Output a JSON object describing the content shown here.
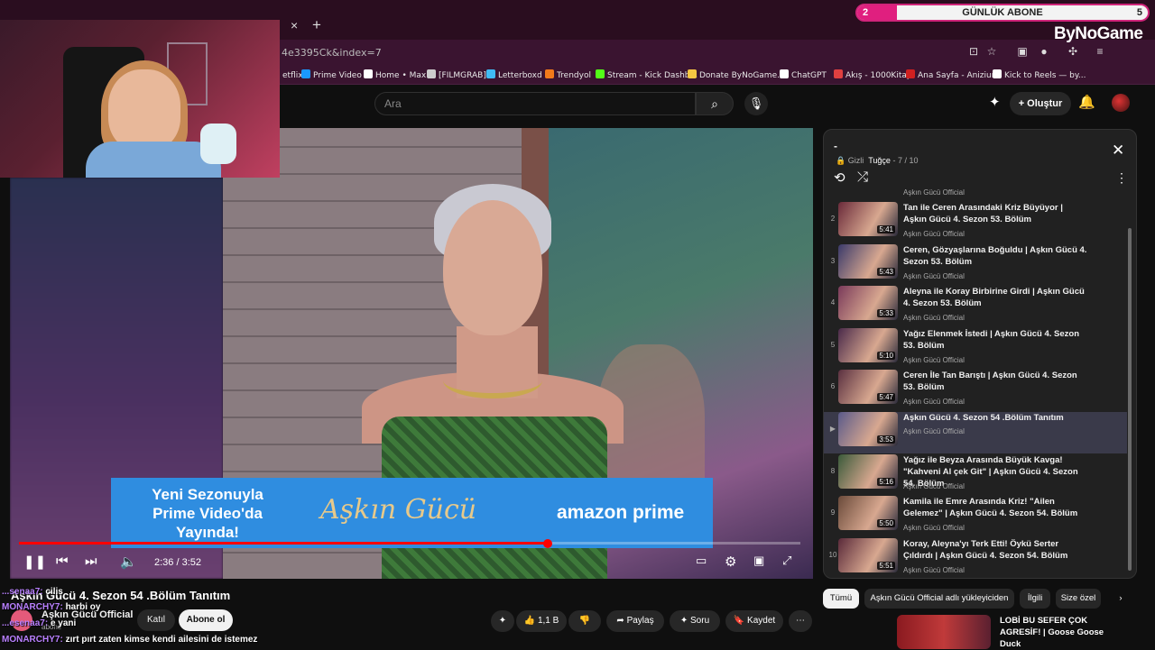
{
  "browser": {
    "tab_close": "×",
    "tab_new": "+",
    "url": "4e3395Ck&index=7",
    "bookmarks": [
      {
        "label": "etflix",
        "color": "#e50914"
      },
      {
        "label": "Prime Video",
        "color": "#1a98ff"
      },
      {
        "label": "Home • Max",
        "color": "#ffffff"
      },
      {
        "label": "[FILMGRAB]",
        "color": "#cccccc"
      },
      {
        "label": "Letterboxd",
        "color": "#40bcf4"
      },
      {
        "label": "Trendyol",
        "color": "#f27a1a"
      },
      {
        "label": "Stream - Kick Dashb...",
        "color": "#53fc18"
      },
      {
        "label": "Donate ByNoGame...",
        "color": "#f5c542"
      },
      {
        "label": "ChatGPT",
        "color": "#ffffff"
      },
      {
        "label": "Akış - 1000Kitap",
        "color": "#e04040"
      },
      {
        "label": "Ana Sayfa - Anizium",
        "color": "#d02020"
      },
      {
        "label": "Kick to Reels — by...",
        "color": "#ffffff"
      }
    ]
  },
  "overlay": {
    "abone_start": "2",
    "abone_label": "GÜNLÜK ABONE",
    "abone_end": "5",
    "brand": "ByNoGame"
  },
  "yt": {
    "search_placeholder": "Ara",
    "create_label": "Oluştur"
  },
  "player": {
    "ad_left": "Yeni Sezonuyla Prime Video'da Yayında!",
    "ad_mid": "Aşkın Gücü",
    "ad_right": "amazon prime",
    "time": "2:36 / 3:52",
    "progress": 0.677
  },
  "playlist": {
    "title": "-",
    "visibility": "Gizli",
    "owner": "Tuğçe",
    "position": "- 7 / 10",
    "top_channel": "Aşkın Gücü Official",
    "items": [
      {
        "idx": "2",
        "title": "Tan ile Ceren Arasındaki Kriz Büyüyor | Aşkın Gücü 4. Sezon 53. Bölüm",
        "channel": "Aşkın Gücü Official",
        "dur": "5:41"
      },
      {
        "idx": "3",
        "title": "Ceren, Gözyaşlarına Boğuldu | Aşkın Gücü 4. Sezon 53. Bölüm",
        "channel": "Aşkın Gücü Official",
        "dur": "5:43"
      },
      {
        "idx": "4",
        "title": "Aleyna ile Koray Birbirine Girdi | Aşkın Gücü 4. Sezon 53. Bölüm",
        "channel": "Aşkın Gücü Official",
        "dur": "5:33"
      },
      {
        "idx": "5",
        "title": "Yağız Elenmek İstedi | Aşkın Gücü 4. Sezon 53. Bölüm",
        "channel": "Aşkın Gücü Official",
        "dur": "5:10"
      },
      {
        "idx": "6",
        "title": "Ceren İle Tan Barıştı | Aşkın Gücü 4. Sezon 53. Bölüm",
        "channel": "Aşkın Gücü Official",
        "dur": "5:47"
      },
      {
        "idx": "▶",
        "title": "Aşkın Gücü 4. Sezon 54 .Bölüm Tanıtım",
        "channel": "Aşkın Gücü Official",
        "dur": "3:53"
      },
      {
        "idx": "8",
        "title": "Yağız ile Beyza Arasında Büyük Kavga! \"Kahveni Al çek Git\" | Aşkın Gücü 4. Sezon 54. Bölüm",
        "channel": "Aşkın Gücü Official",
        "dur": "5:16"
      },
      {
        "idx": "9",
        "title": "Kamila ile Emre Arasında Kriz! \"Ailen Gelemez\" | Aşkın Gücü 4. Sezon 54. Bölüm",
        "channel": "Aşkın Gücü Official",
        "dur": "5:50"
      },
      {
        "idx": "10",
        "title": "Koray, Aleyna'yı Terk Etti! Öykü Serter Çıldırdı | Aşkın Gücü 4. Sezon 54. Bölüm",
        "channel": "Aşkın Gücü Official",
        "dur": "5:51"
      }
    ]
  },
  "video": {
    "title": "Aşkın Gücü 4. Sezon 54 .Bölüm Tanıtım",
    "channel": "Aşkın Gücü Official",
    "subs": "abone",
    "join": "Katıl",
    "subscribe": "Abone ol",
    "likes": "1,1 B",
    "share": "Paylaş",
    "ask": "Soru",
    "save": "Kaydet"
  },
  "chips": [
    "Tümü",
    "Aşkın Gücü Official adlı yükleyiciden",
    "İlgili",
    "Size özel"
  ],
  "recommendation": {
    "title": "LOBİ BU SEFER ÇOK AGRESİF! | Goose Goose Duck"
  },
  "chat": [
    {
      "user": "...senaa7:",
      "msg": "cilis"
    },
    {
      "user": "MONARCHY7:",
      "msg": "harbi oy"
    },
    {
      "user": "...esenaa7:",
      "msg": "e yani"
    },
    {
      "user": "MONARCHY7:",
      "msg": "zırt pırt zaten kimse kendi ailesini de istemez"
    }
  ]
}
